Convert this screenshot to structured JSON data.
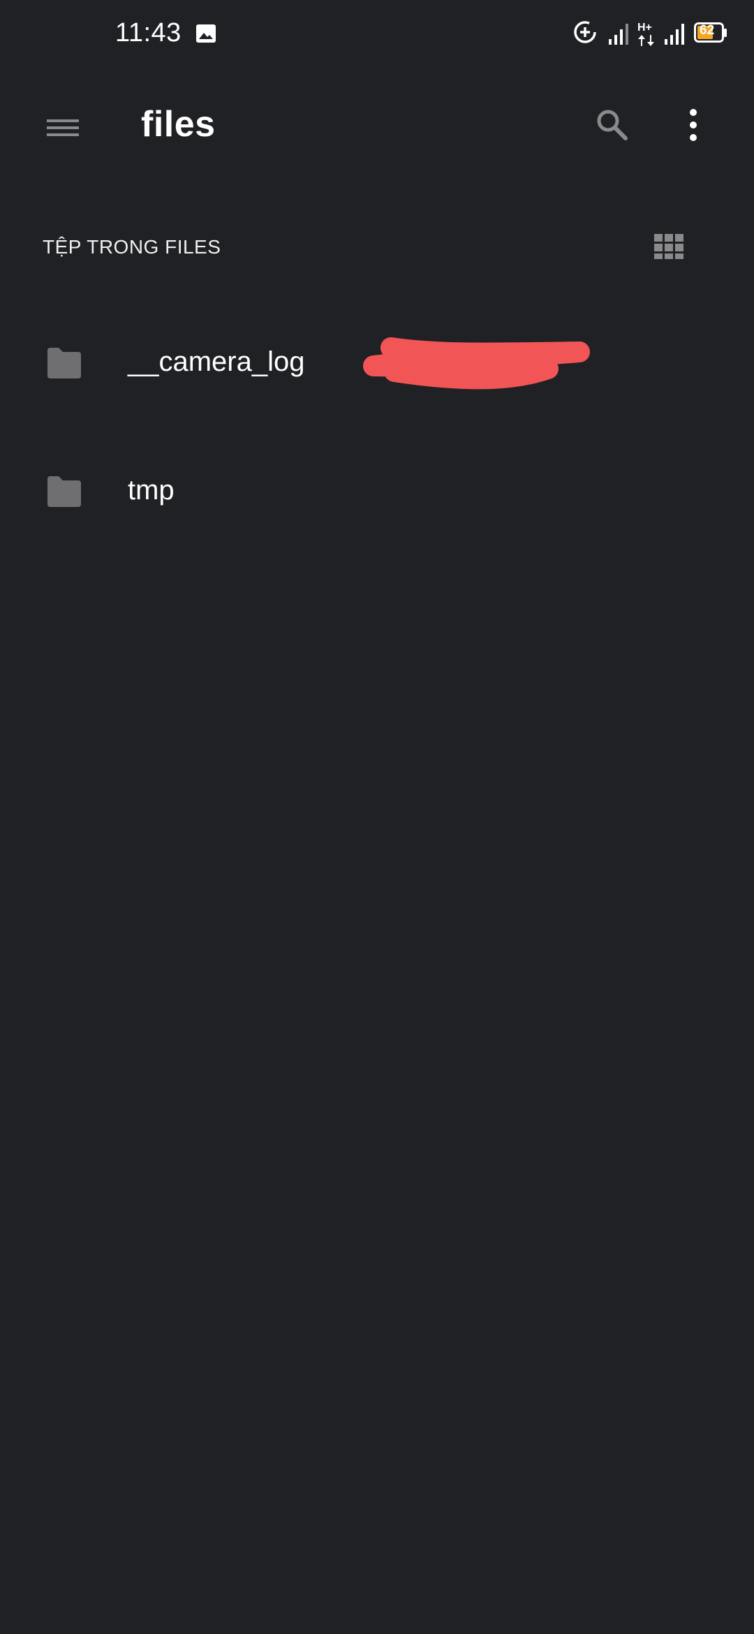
{
  "status_bar": {
    "time": "11:43",
    "battery_level": "62",
    "icons": [
      "image-icon",
      "data-saver-icon",
      "signal-icon",
      "hplus-data-icon",
      "signal-icon",
      "battery-icon"
    ]
  },
  "app_bar": {
    "title": "files",
    "menu_icon": "hamburger-menu-icon",
    "search_icon": "search-icon",
    "more_icon": "more-vert-icon"
  },
  "section": {
    "title": "TỆP TRONG FILES",
    "view_toggle_icon": "grid-view-icon"
  },
  "files": [
    {
      "name": "__camera_log",
      "icon": "folder-icon"
    },
    {
      "name": "tmp",
      "icon": "folder-icon"
    }
  ],
  "colors": {
    "background": "#202125",
    "text": "#ffffff",
    "icon_gray": "#8a8a8c",
    "folder_gray": "#6f6f71",
    "redaction": "#f25555",
    "battery_fill": "#f5a623"
  }
}
